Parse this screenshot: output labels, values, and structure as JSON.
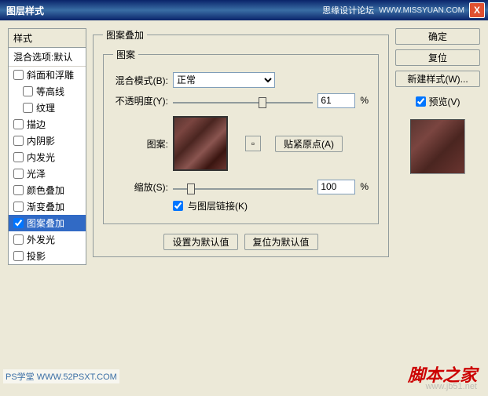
{
  "titlebar": {
    "title": "图层样式",
    "forum": "思缘设计论坛",
    "url": "WWW.MISSYUAN.COM",
    "close": "X"
  },
  "styles": {
    "header": "样式",
    "blend_default": "混合选项:默认",
    "items": [
      {
        "label": "斜面和浮雕",
        "checked": false,
        "indent": false
      },
      {
        "label": "等高线",
        "checked": false,
        "indent": true
      },
      {
        "label": "纹理",
        "checked": false,
        "indent": true
      },
      {
        "label": "描边",
        "checked": false,
        "indent": false
      },
      {
        "label": "内阴影",
        "checked": false,
        "indent": false
      },
      {
        "label": "内发光",
        "checked": false,
        "indent": false
      },
      {
        "label": "光泽",
        "checked": false,
        "indent": false
      },
      {
        "label": "颜色叠加",
        "checked": false,
        "indent": false
      },
      {
        "label": "渐变叠加",
        "checked": false,
        "indent": false
      },
      {
        "label": "图案叠加",
        "checked": true,
        "indent": false,
        "selected": true
      },
      {
        "label": "外发光",
        "checked": false,
        "indent": false
      },
      {
        "label": "投影",
        "checked": false,
        "indent": false
      }
    ]
  },
  "main": {
    "section_title": "图案叠加",
    "pattern_group": "图案",
    "blend_mode_label": "混合模式(B):",
    "blend_mode_value": "正常",
    "opacity_label": "不透明度(Y):",
    "opacity_value": "61",
    "opacity_unit": "%",
    "pattern_label": "图案:",
    "snap_button": "贴紧原点(A)",
    "scale_label": "缩放(S):",
    "scale_value": "100",
    "scale_unit": "%",
    "link_layer_label": "与图层链接(K)",
    "link_layer_checked": true,
    "set_default": "设置为默认值",
    "reset_default": "复位为默认值"
  },
  "right": {
    "ok": "确定",
    "reset": "复位",
    "new_style": "新建样式(W)...",
    "preview_label": "预览(V)",
    "preview_checked": true
  },
  "watermarks": {
    "ps": "PS学堂  WWW.52PSXT.COM",
    "site": "脚本之家",
    "url": "www.jb51.net"
  }
}
